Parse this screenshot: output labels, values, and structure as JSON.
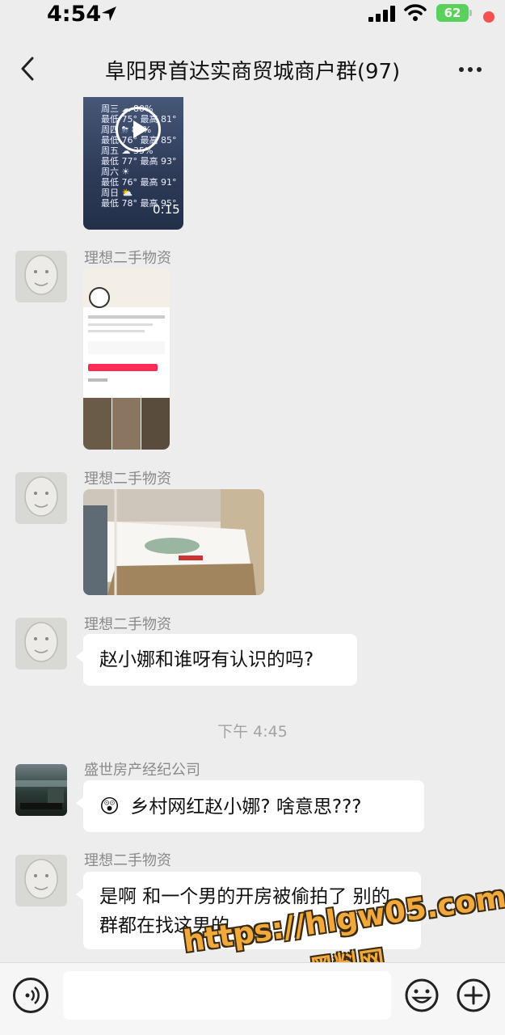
{
  "status_bar": {
    "time": "4:54",
    "battery": "62"
  },
  "nav": {
    "title": "阜阳界首达实商贸城商户群(97)"
  },
  "messages": [
    {
      "type": "video",
      "duration": "0:15",
      "weather_rows": [
        "周三 ☁ 80%",
        "最低 75° 最高 81°",
        "周四 ⛈ 80%",
        "最低 76° 最高 85°",
        "周五 ☁ 35%",
        "最低 77° 最高 93°",
        "周六 ☀",
        "最低 76° 最高 91°",
        "周日 ⛅",
        "最低 78° 最高 95°"
      ]
    },
    {
      "sender": "理想二手物资",
      "type": "image",
      "image_kind": "phone-screenshot"
    },
    {
      "sender": "理想二手物资",
      "type": "image",
      "image_kind": "photo"
    },
    {
      "sender": "理想二手物资",
      "type": "text",
      "text": "赵小娜和谁呀有认识的吗?"
    },
    {
      "type": "timestamp",
      "text": "下午 4:45"
    },
    {
      "sender": "盛世房产经纪公司",
      "type": "text",
      "emoji": "😲",
      "text": "乡村网红赵小娜?  啥意思???"
    },
    {
      "sender": "理想二手物资",
      "type": "text",
      "text": "是啊 和一个男的开房被偷拍了 别的群都在找这男的"
    }
  ],
  "watermark": {
    "url": "https://hlgw05.com",
    "name": "黑料网"
  },
  "colors": {
    "background": "#ededed",
    "bubble": "#ffffff",
    "battery": "#5ad15a",
    "badge": "#f45050",
    "watermark": "#f2a93b"
  }
}
